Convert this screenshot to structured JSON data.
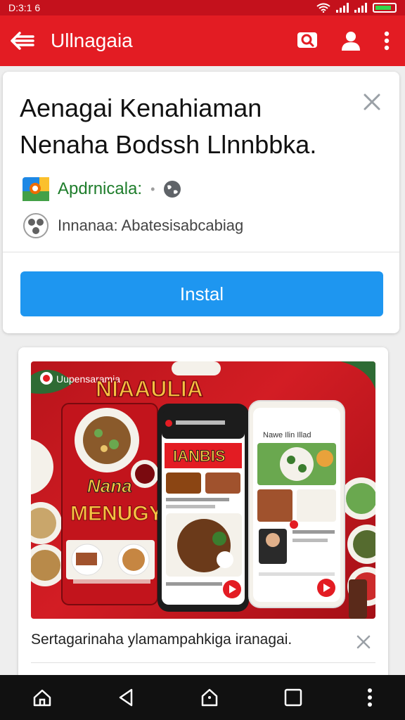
{
  "status_bar": {
    "time": "D:3:1 6",
    "accent": "#c4111c"
  },
  "app_bar": {
    "title": "Ullnagaia",
    "background": "#e31c23"
  },
  "app_card": {
    "headline_line1": "Aenagai Kenahiaman",
    "headline_line2": "Nenaha Bodssh Llnnbbka.",
    "developer": "Apdrnicala:",
    "rating_text": "Innanaa: Abatesisabcabiag",
    "install_label": "Instal",
    "install_color": "#1e96f0"
  },
  "promo_card": {
    "image_badge": "Uupensaramia",
    "brand_main": "NIAAULIA",
    "brand_small": "Nana",
    "brand_big": "MENUGY",
    "phone2_banner": "IANBIS",
    "phone3_title": "Nawe Ilin Illad",
    "caption": "Sertagarinaha ylamampahkiga iranagai."
  },
  "nav_bar": {
    "icons": [
      "home-icon",
      "back-icon",
      "house-icon",
      "recent-apps-icon",
      "more-icon"
    ]
  }
}
